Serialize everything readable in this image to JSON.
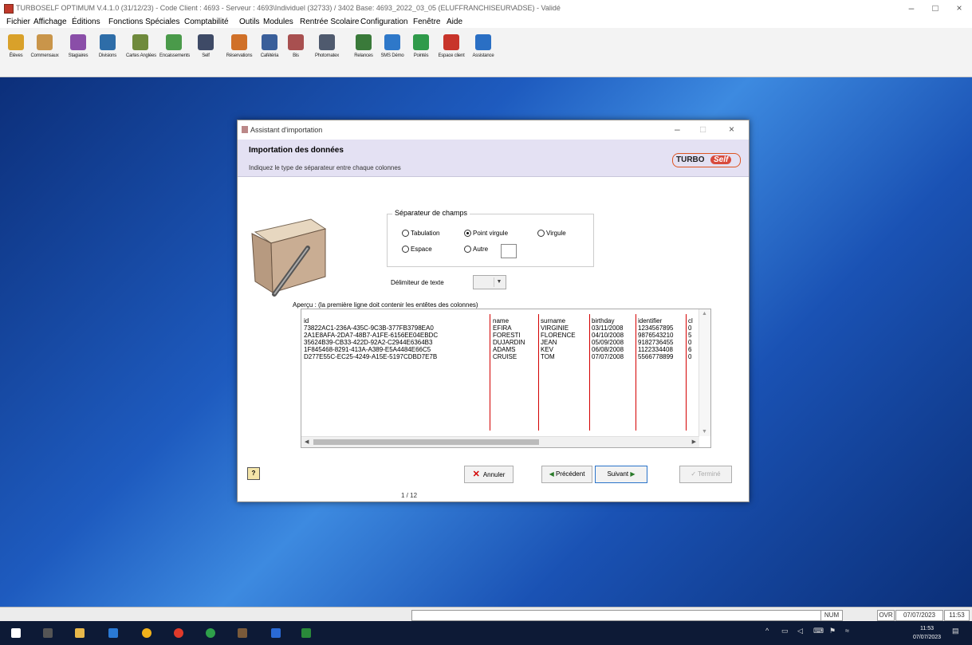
{
  "window": {
    "title": "TURBOSELF OPTIMUM V.4.1.0 (31/12/23) - Code Client : 4693 - Serveur : 4693\\Individuel (32733) / 3402 Base: 4693_2022_03_05 (ELUFFRANCHISEUR\\ADSE) - Validé",
    "minimize": "–",
    "maximize": "□",
    "close": "×"
  },
  "menu": [
    "Fichier",
    "Affichage",
    "Éditions",
    "Fonctions Spéciales",
    "Comptabilité",
    "Outils",
    "Modules",
    "Rentrée Scolaire",
    "Configuration",
    "Fenêtre",
    "Aide"
  ],
  "toolbar": [
    {
      "label": "Élèves",
      "color": "#d9a12a"
    },
    {
      "label": "Commensaux",
      "color": "#c9954a"
    },
    {
      "label": "Stagiaires",
      "color": "#8a4ea8"
    },
    {
      "label": "Divisions",
      "color": "#2e6da8"
    },
    {
      "label": "Cartes Anglées",
      "color": "#6f8a3c"
    },
    {
      "label": "Encaissements",
      "color": "#4a9a4a"
    },
    {
      "label": "Self",
      "color": "#3e4a66"
    },
    {
      "label": "Réservations",
      "color": "#d07028"
    },
    {
      "label": "Cafétéria",
      "color": "#3a5f9a"
    },
    {
      "label": "Bis",
      "color": "#a85050"
    },
    {
      "label": "Photomatex",
      "color": "#4f5a6e"
    },
    {
      "label": "Relances",
      "color": "#3a7a3a"
    },
    {
      "label": "SMS Démo",
      "color": "#2e78c9"
    },
    {
      "label": "Pointés",
      "color": "#2f9a4a"
    },
    {
      "label": "Espace client",
      "color": "#c8342a"
    },
    {
      "label": "Assistance",
      "color": "#2a6fc4"
    }
  ],
  "dialog": {
    "title": "Assistant d'importation",
    "header_title": "Importation des données",
    "header_subtitle": "Indiquez le type de séparateur entre chaque colonnes",
    "logo_part1": "TURBO",
    "logo_part2": "Self",
    "separator_group_label": "Séparateur de champs",
    "radios": [
      {
        "label": "Tabulation",
        "checked": false
      },
      {
        "label": "Point virgule",
        "checked": true
      },
      {
        "label": "Virgule",
        "checked": false
      },
      {
        "label": "Espace",
        "checked": false
      },
      {
        "label": "Autre",
        "checked": false
      }
    ],
    "text_delimiter_label": "Délimiteur de texte",
    "text_delimiter_value": "",
    "preview_label": "Aperçu : (la première ligne doit contenir les entêtes des colonnes)",
    "preview": {
      "columns": [
        "id",
        "name",
        "surname",
        "birthday",
        "identifier",
        "cl"
      ],
      "rows": [
        [
          "73822AC1-236A-435C-9C3B-377FB3798EA0",
          "EFIRA",
          "VIRGINIE",
          "03/11/2008",
          "1234567895",
          "0"
        ],
        [
          "2A1E8AFA-2DA7-48B7-A1FE-6156EE04EBDC",
          "FORESTI",
          "FLORENCE",
          "04/10/2008",
          "9876543210",
          "5"
        ],
        [
          "35624B39-CB33-422D-92A2-C2944E6364B3",
          "DUJARDIN",
          "JEAN",
          "05/09/2008",
          "9182736455",
          "0"
        ],
        [
          "1F845468-8291-413A-A389-E5A4484E66C5",
          "ADAMS",
          "KEV",
          "06/08/2008",
          "1122334408",
          "6"
        ],
        [
          "D277E55C-EC25-4249-A15E-5197CDBD7E7B",
          "CRUISE",
          "TOM",
          "07/07/2008",
          "5566778899",
          "0"
        ]
      ]
    },
    "buttons": {
      "cancel": "Annuler",
      "previous": "Précédent",
      "next": "Suivant",
      "finish": "Terminé"
    },
    "page_indicator": "1 / 12"
  },
  "statusbar": {
    "num": "NUM",
    "ovr": "OVR",
    "date": "07/07/2023",
    "time": "11:53"
  },
  "taskbar": {
    "clock_time": "11:53",
    "clock_date": "07/07/2023"
  }
}
